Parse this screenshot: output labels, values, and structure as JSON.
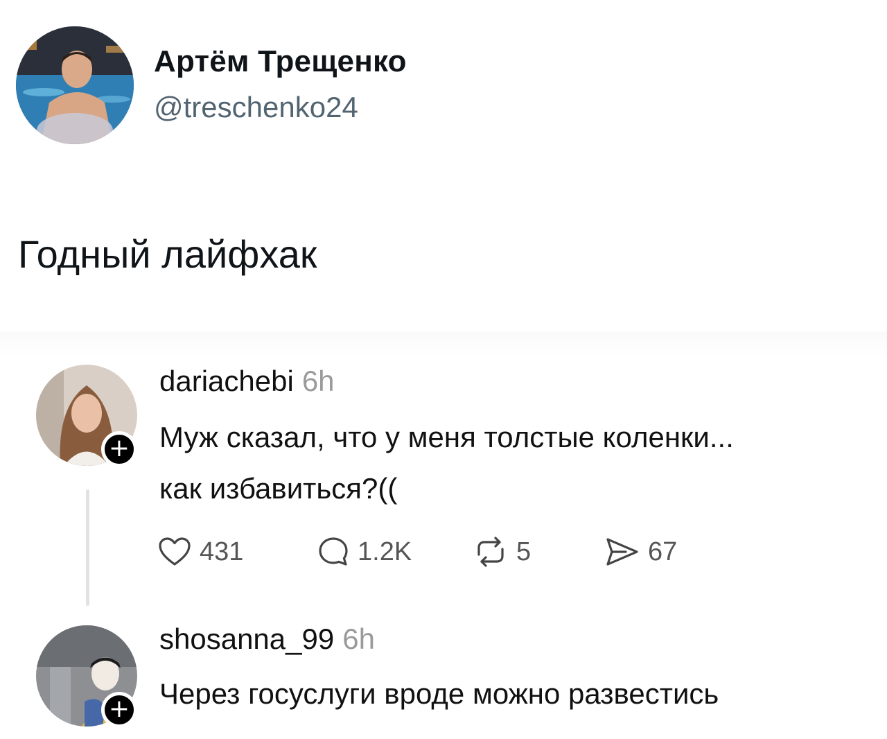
{
  "tweet": {
    "author_name": "Артём Трещенко",
    "author_handle": "@treschenko24",
    "text": "Годный лайфхак"
  },
  "embed": {
    "comments": [
      {
        "username": "dariachebi",
        "time": "6h",
        "text_line1": "Муж сказал, что у меня толстые коленки...",
        "text_line2": "как избавиться?((",
        "badge": "+",
        "actions": {
          "likes": "431",
          "replies": "1.2K",
          "reposts": "5",
          "shares": "67"
        }
      },
      {
        "username": "shosanna_99",
        "time": "6h",
        "text_line1": "Через госуслуги вроде можно развестись",
        "badge": "+"
      }
    ]
  },
  "icons": {
    "like": "heart-icon",
    "reply": "comment-bubble-icon",
    "repost": "repost-icon",
    "share": "send-icon",
    "follow": "plus-icon"
  },
  "colors": {
    "text_primary": "#0f1419",
    "handle_gray": "#536471",
    "time_gray": "#9a9a9a",
    "badge_black": "#000000"
  }
}
